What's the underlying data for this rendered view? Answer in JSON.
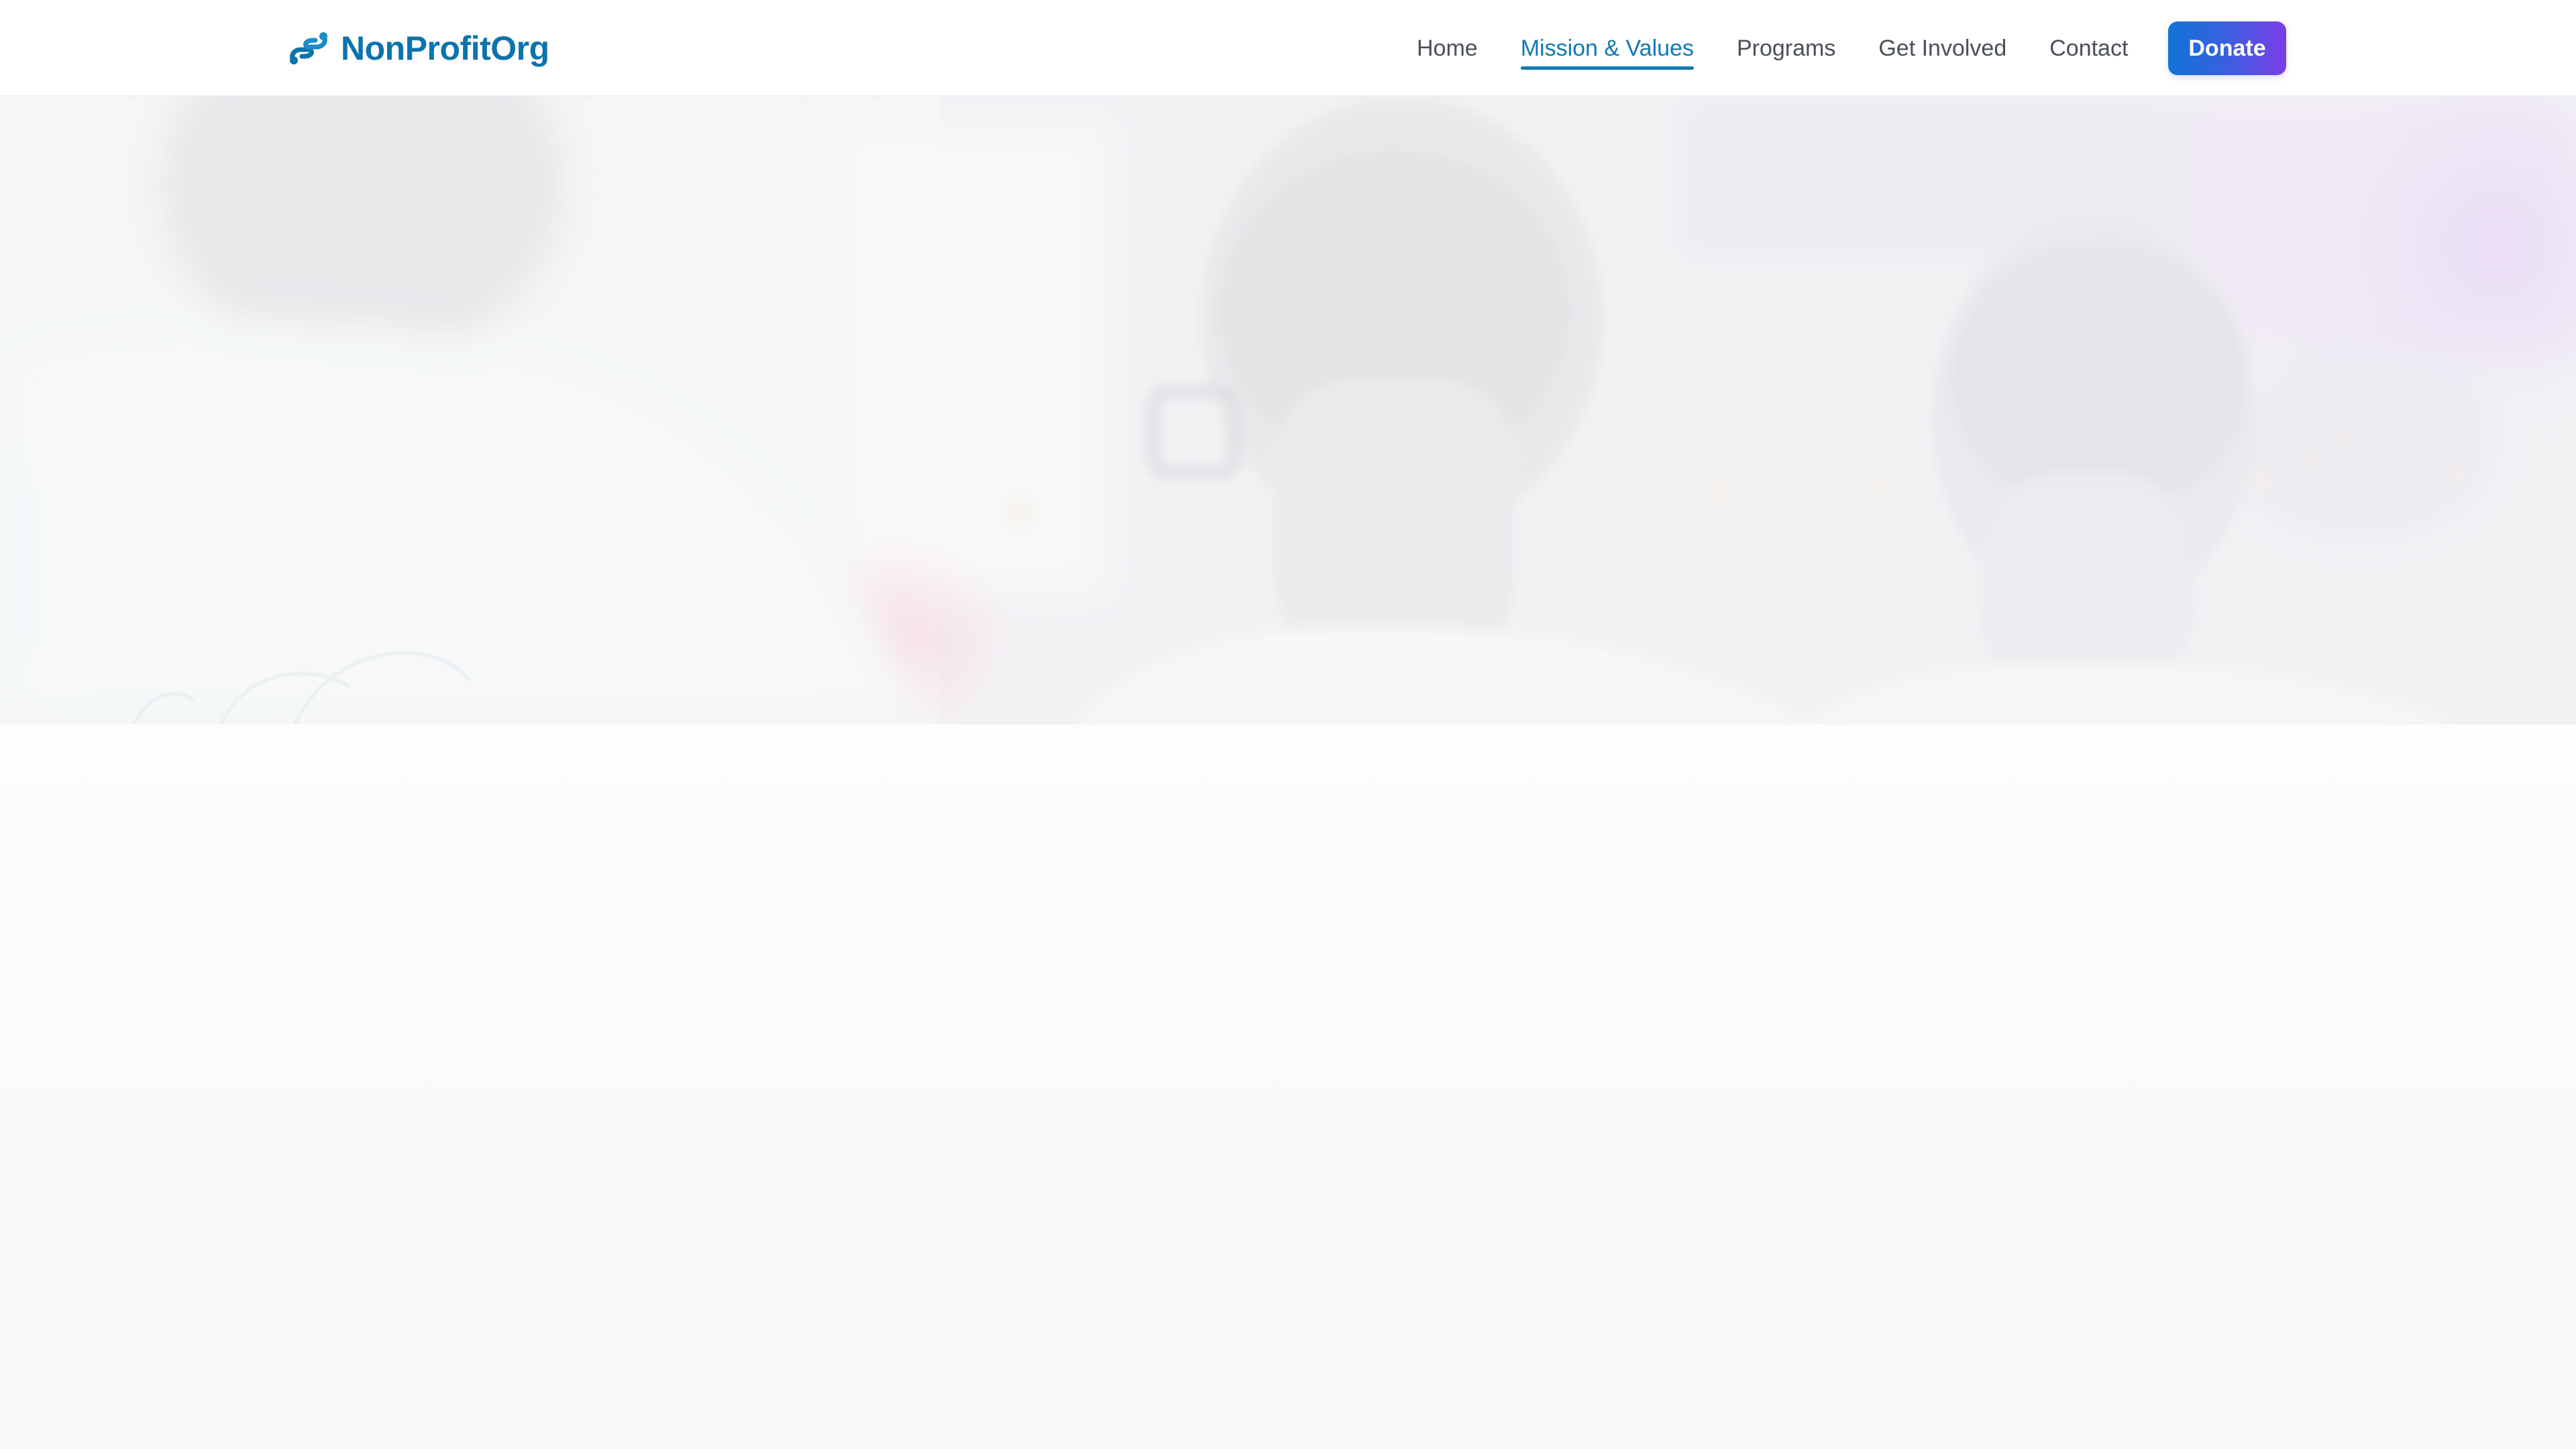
{
  "header": {
    "brand_name": "NonProfitOrg",
    "brand_icon": "helping-hands-icon",
    "nav": [
      {
        "label": "Home",
        "active": false
      },
      {
        "label": "Mission & Values",
        "active": true
      },
      {
        "label": "Programs",
        "active": false
      },
      {
        "label": "Get Involved",
        "active": false
      },
      {
        "label": "Contact",
        "active": false
      }
    ],
    "donate_label": "Donate"
  },
  "theme": {
    "brand_color": "#0c73ad",
    "active_nav_color": "#1178b2",
    "donate_gradient_start": "#1274d6",
    "donate_gradient_end": "#7b3de8"
  }
}
